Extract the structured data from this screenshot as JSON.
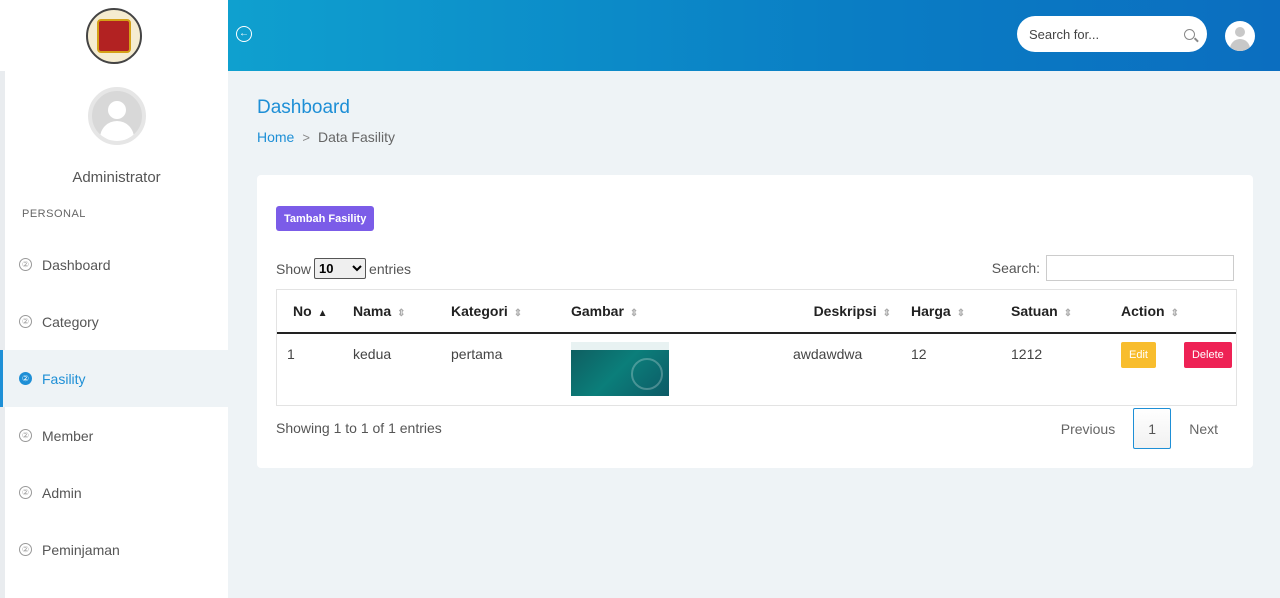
{
  "sidebar": {
    "user_name": "Administrator",
    "section_title": "PERSONAL",
    "items": [
      {
        "label": "Dashboard",
        "icon": "circle-icon",
        "active": false
      },
      {
        "label": "Category",
        "icon": "circle-icon",
        "active": false
      },
      {
        "label": "Fasility",
        "icon": "circle-icon",
        "active": true
      },
      {
        "label": "Member",
        "icon": "circle-icon",
        "active": false
      },
      {
        "label": "Admin",
        "icon": "circle-icon",
        "active": false
      },
      {
        "label": "Peminjaman",
        "icon": "circle-icon",
        "active": false
      }
    ]
  },
  "header": {
    "search_placeholder": "Search for..."
  },
  "main": {
    "title": "Dashboard",
    "breadcrumb": {
      "home": "Home",
      "current": "Data Fasility"
    },
    "add_button": "Tambah Fasility",
    "show_label": "Show",
    "entries_label": "entries",
    "page_size": "10",
    "search_label": "Search:",
    "table": {
      "columns": [
        "No",
        "Nama",
        "Kategori",
        "Gambar",
        "Deskripsi",
        "Harga",
        "Satuan",
        "Action"
      ],
      "rows": [
        {
          "no": "1",
          "nama": "kedua",
          "kategori": "pertama",
          "gambar": "image-thumbnail",
          "deskripsi": "awdawdwa",
          "harga": "12",
          "satuan": "1212"
        }
      ],
      "edit_label": "Edit",
      "delete_label": "Delete"
    },
    "info": "Showing 1 to 1 of 1 entries",
    "pagination": {
      "previous": "Previous",
      "current_page": "1",
      "next": "Next"
    }
  },
  "colors": {
    "accent": "#1e8fd6",
    "add_button": "#7b5ce8",
    "edit_button": "#f8bd2d",
    "delete_button": "#ee2255"
  }
}
